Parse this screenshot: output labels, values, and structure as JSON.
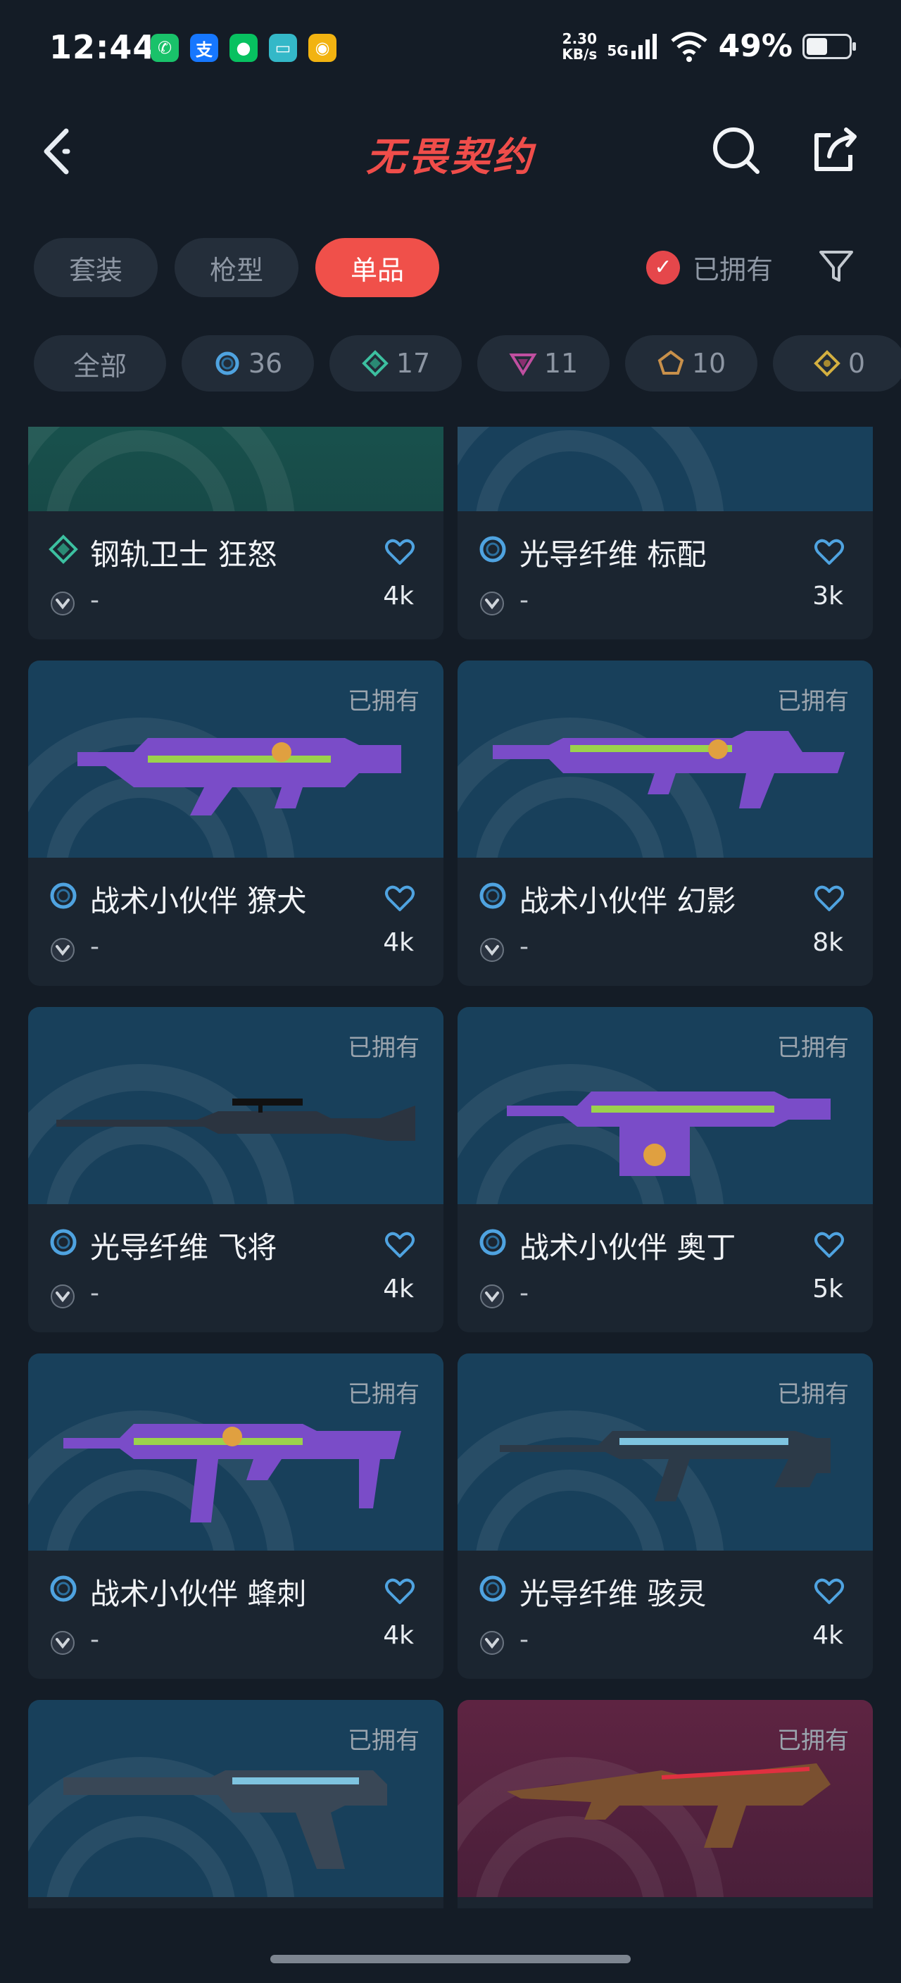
{
  "status_bar": {
    "time": "12:44",
    "net_speed_value": "2.30",
    "net_speed_unit": "KB/s",
    "network": "5G",
    "battery": "49%",
    "notification_icons": [
      "phone-app-icon",
      "alipay-icon",
      "wechat-icon",
      "messages-icon",
      "gallery-icon"
    ]
  },
  "header": {
    "title": "无畏契约",
    "back_icon": "back-icon",
    "search_icon": "search-icon",
    "share_icon": "share-icon"
  },
  "tabs": [
    {
      "label": "套装",
      "active": false
    },
    {
      "label": "枪型",
      "active": false
    },
    {
      "label": "单品",
      "active": true
    }
  ],
  "owned_filter": {
    "label": "已拥有",
    "checked": true
  },
  "filter_icon": "filter-icon",
  "rarity_chips": [
    {
      "label": "全部",
      "icon": ""
    },
    {
      "label": "36",
      "icon": "select-tier-icon",
      "color": "#4fa3e0"
    },
    {
      "label": "17",
      "icon": "deluxe-tier-icon",
      "color": "#3cc0a0"
    },
    {
      "label": "11",
      "icon": "premium-tier-icon",
      "color": "#c04fa0"
    },
    {
      "label": "10",
      "icon": "exclusive-tier-icon",
      "color": "#c8904a"
    },
    {
      "label": "0",
      "icon": "ultra-tier-icon",
      "color": "#d4b040"
    }
  ],
  "cards": [
    {
      "name": "钢轨卫士 狂怒",
      "owned_label": "",
      "likes": "4k",
      "level": "-",
      "rarity": "deluxe",
      "bg": "green"
    },
    {
      "name": "光导纤维 标配",
      "owned_label": "",
      "likes": "3k",
      "level": "-",
      "rarity": "select",
      "bg": "blue"
    },
    {
      "name": "战术小伙伴 獠犬",
      "owned_label": "已拥有",
      "likes": "4k",
      "level": "-",
      "rarity": "select",
      "bg": "blue"
    },
    {
      "name": "战术小伙伴 幻影",
      "owned_label": "已拥有",
      "likes": "8k",
      "level": "-",
      "rarity": "select",
      "bg": "blue"
    },
    {
      "name": "光导纤维 飞将",
      "owned_label": "已拥有",
      "likes": "4k",
      "level": "-",
      "rarity": "select",
      "bg": "blue"
    },
    {
      "name": "战术小伙伴 奥丁",
      "owned_label": "已拥有",
      "likes": "5k",
      "level": "-",
      "rarity": "select",
      "bg": "blue"
    },
    {
      "name": "战术小伙伴 蜂刺",
      "owned_label": "已拥有",
      "likes": "4k",
      "level": "-",
      "rarity": "select",
      "bg": "blue"
    },
    {
      "name": "光导纤维 骇灵",
      "owned_label": "已拥有",
      "likes": "4k",
      "level": "-",
      "rarity": "select",
      "bg": "blue"
    },
    {
      "name": "",
      "owned_label": "已拥有",
      "likes": "",
      "level": "",
      "rarity": "select",
      "bg": "blue"
    },
    {
      "name": "",
      "owned_label": "已拥有",
      "likes": "",
      "level": "",
      "rarity": "premium",
      "bg": "red"
    }
  ]
}
